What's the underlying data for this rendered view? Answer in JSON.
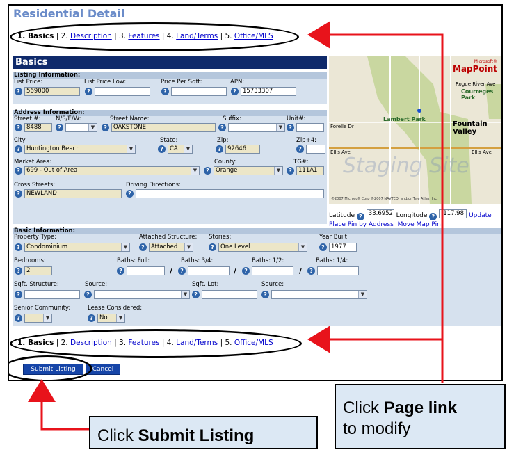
{
  "page": {
    "title": "Residential Detail"
  },
  "nav": {
    "items": [
      {
        "num": "1.",
        "label": "Basics",
        "current": true
      },
      {
        "num": "2.",
        "label": "Description",
        "current": false
      },
      {
        "num": "3.",
        "label": "Features",
        "current": false
      },
      {
        "num": "4.",
        "label": "Land/Terms",
        "current": false
      },
      {
        "num": "5.",
        "label": "Office/MLS",
        "current": false
      }
    ],
    "sep": "|"
  },
  "section_title": "Basics",
  "listing": {
    "header": "Listing Information:",
    "list_price_label": "List Price:",
    "list_price": "569000",
    "list_price_low_label": "List Price Low:",
    "list_price_low": "",
    "price_per_sqft_label": "Price Per Sqft:",
    "price_per_sqft": "",
    "apn_label": "APN:",
    "apn": "15733307"
  },
  "address": {
    "header": "Address Information:",
    "street_num_label": "Street #:",
    "street_num": "8488",
    "nsew_label": "N/S/E/W:",
    "nsew": "",
    "street_name_label": "Street Name:",
    "street_name": "OAKSTONE",
    "suffix_label": "Suffix:",
    "suffix": "",
    "unit_label": "Unit#:",
    "unit": "",
    "city_label": "City:",
    "city": "Huntington Beach",
    "state_label": "State:",
    "state": "CA",
    "zip_label": "Zip:",
    "zip": "92646",
    "zip4_label": "Zip+4:",
    "zip4": "",
    "market_area_label": "Market Area:",
    "market_area": "699 - Out of Area",
    "county_label": "County:",
    "county": "Orange",
    "tg_label": "TG#:",
    "tg": "111A1",
    "cross_streets_label": "Cross Streets:",
    "cross_streets": "NEWLAND",
    "driving_directions_label": "Driving Directions:",
    "driving_directions": ""
  },
  "map": {
    "brand_top": "Microsoft®",
    "brand": "MapPoint",
    "labels": {
      "lambert": "Lambert Park",
      "fountain": "Fountain Valley",
      "courreges": "Courreges Park",
      "rogue": "Rogue River Ave",
      "forelle": "Forelle Dr",
      "ellis_w": "Ellis Ave",
      "ellis_e": "Ellis Ave",
      "copyright": "©2007 Microsoft Corp ©2007 NAVTEQ, and/or Tele Atlas, Inc."
    },
    "watermark": "Staging Site",
    "latitude_label": "Latitude",
    "latitude": "33.6952",
    "longitude_label": "Longitude",
    "longitude": "-117.98",
    "update_label": "Update",
    "place_pin_label": "Place Pin by Address",
    "move_pin_label": "Move Map Pin"
  },
  "basic": {
    "header": "Basic Information:",
    "property_type_label": "Property Type:",
    "property_type": "Condominium",
    "attached_label": "Attached Structure:",
    "attached": "Attached",
    "stories_label": "Stories:",
    "stories": "One Level",
    "year_built_label": "Year Built:",
    "year_built": "1977",
    "bedrooms_label": "Bedrooms:",
    "bedrooms": "2",
    "baths_full_label": "Baths: Full:",
    "baths_34_label": "Baths: 3/4:",
    "baths_12_label": "Baths: 1/2:",
    "baths_14_label": "Baths: 1/4:",
    "slash": "/",
    "sqft_structure_label": "Sqft. Structure:",
    "source_label": "Source:",
    "sqft_lot_label": "Sqft. Lot:",
    "source2_label": "Source:",
    "senior_label": "Senior Community:",
    "lease_label": "Lease Considered:",
    "lease": "No"
  },
  "buttons": {
    "submit": "Submit Listing",
    "cancel": "Cancel"
  },
  "callouts": {
    "submit": {
      "prefix": "Click ",
      "bold": "Submit Listing"
    },
    "page": {
      "prefix": "Click ",
      "bold": "Page link",
      "line2": "to modify"
    }
  },
  "colors": {
    "annotation_red": "#e8131b",
    "header_navy": "#0f2a6b",
    "title_blue": "#6b8cc9"
  }
}
